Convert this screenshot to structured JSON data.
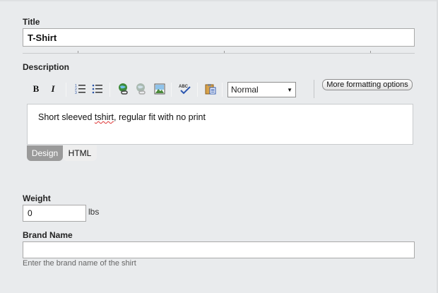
{
  "title_field": {
    "label": "Title",
    "value": "T-Shirt"
  },
  "description": {
    "label": "Description",
    "toolbar": {
      "bold": "B",
      "italic": "I",
      "format_value": "Normal",
      "more_formatting": "More formatting options",
      "icons": [
        "bold-icon",
        "italic-icon",
        "ordered-list-icon",
        "unordered-list-icon",
        "insert-link-icon",
        "remove-link-icon",
        "insert-image-icon",
        "spellcheck-icon",
        "paste-icon"
      ]
    },
    "content_before": "Short sleeved ",
    "content_misspelled": "tshirt",
    "content_after": ", regular fit with no print",
    "tabs": {
      "design": "Design",
      "html": "HTML"
    }
  },
  "weight": {
    "label": "Weight",
    "value": "0",
    "unit": "lbs"
  },
  "brand": {
    "label": "Brand Name",
    "value": "",
    "hint": "Enter the brand name of the shirt"
  }
}
